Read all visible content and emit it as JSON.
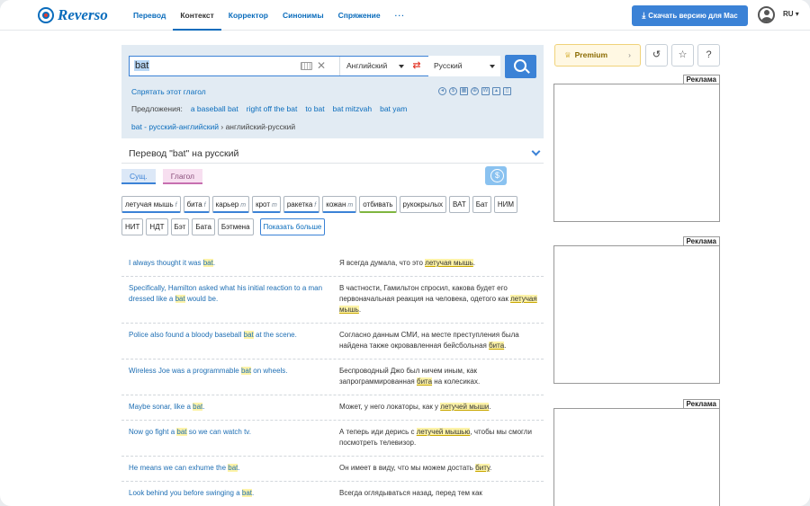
{
  "brand": {
    "name": "Reverso"
  },
  "nav": {
    "items": [
      {
        "label": "Перевод",
        "active": false
      },
      {
        "label": "Контекст",
        "active": true
      },
      {
        "label": "Корректор",
        "active": false
      },
      {
        "label": "Синонимы",
        "active": false
      },
      {
        "label": "Спряжение",
        "active": false
      }
    ],
    "more": "···"
  },
  "header": {
    "mac_button": "Скачать версию для Mac",
    "language": "RU ▾"
  },
  "search": {
    "query": "bat",
    "source_lang": "Английский",
    "target_lang": "Русский",
    "hide_verb": "Спрятать этот глагол",
    "suggestions_label": "Предложения:",
    "suggestions": [
      "a baseball bat",
      "right off the bat",
      "to bat",
      "bat mitzvah",
      "bat yam"
    ],
    "crumb_link": "bat - русский-английский",
    "crumb_sep": "›",
    "crumb_current": "английский-русский"
  },
  "translation": {
    "title": "Перевод \"bat\" на русский",
    "pos_tabs": [
      "Сущ.",
      "Глагол"
    ],
    "chips_row1": [
      {
        "text": "летучая мышь",
        "g": "f",
        "type": "noun"
      },
      {
        "text": "бита",
        "g": "f",
        "type": "noun"
      },
      {
        "text": "карьер",
        "g": "m",
        "type": "noun"
      },
      {
        "text": "крот",
        "g": "m",
        "type": "noun"
      },
      {
        "text": "ракетка",
        "g": "f",
        "type": "noun"
      },
      {
        "text": "кожан",
        "g": "m",
        "type": "noun"
      },
      {
        "text": "отбивать",
        "g": "",
        "type": "verb"
      },
      {
        "text": "рукокрылых",
        "g": "",
        "type": "plain"
      },
      {
        "text": "ВАТ",
        "g": "",
        "type": "plain"
      },
      {
        "text": "Бат",
        "g": "",
        "type": "plain"
      },
      {
        "text": "НИМ",
        "g": "",
        "type": "plain"
      }
    ],
    "chips_row2": [
      {
        "text": "НИТ",
        "g": "",
        "type": "plain"
      },
      {
        "text": "НДТ",
        "g": "",
        "type": "plain"
      },
      {
        "text": "Бэт",
        "g": "",
        "type": "plain"
      },
      {
        "text": "Бата",
        "g": "",
        "type": "plain"
      },
      {
        "text": "Бэтмена",
        "g": "",
        "type": "plain"
      }
    ],
    "show_more": "Показать больше"
  },
  "examples": [
    {
      "src": [
        "I always thought it was ",
        "bat",
        "."
      ],
      "tgt": [
        "Я всегда думала, что это ",
        "летучая мышь",
        "."
      ]
    },
    {
      "src": [
        "Specifically, Hamilton asked what his initial reaction to a man dressed like a ",
        "bat",
        " would be."
      ],
      "tgt": [
        "В частности, Гамильтон спросил, какова будет его первоначальная реакция на человека, одетого как ",
        "летучая мышь",
        "."
      ]
    },
    {
      "src": [
        "Police also found a bloody baseball ",
        "bat",
        " at the scene."
      ],
      "tgt": [
        "Согласно данным СМИ, на месте преступления была найдена также окровавленная бейсбольная ",
        "бита",
        "."
      ]
    },
    {
      "src": [
        "Wireless Joe was a programmable ",
        "bat",
        " on wheels."
      ],
      "tgt": [
        "Беспроводный Джо был ничем иным, как запрограммированная ",
        "бита",
        " на колесиках."
      ]
    },
    {
      "src": [
        "Maybe sonar, like a ",
        "bat",
        "."
      ],
      "tgt": [
        "Может, у него локаторы, как у ",
        "летучей мыши",
        "."
      ]
    },
    {
      "src": [
        "Now go fight a ",
        "bat",
        " so we can watch tv."
      ],
      "tgt": [
        "А теперь иди дерись с ",
        "летучей мышью",
        ", чтобы мы смогли посмотреть телевизор."
      ]
    },
    {
      "src": [
        "He means we can exhume the ",
        "bat",
        "."
      ],
      "tgt": [
        "Он имеет в виду, что мы можем достать ",
        "биту",
        "."
      ]
    },
    {
      "src": [
        "Look behind you before swinging a ",
        "bat",
        "."
      ],
      "tgt": [
        "Всегда оглядываться назад, перед тем как",
        "",
        ""
      ]
    }
  ],
  "sidebar": {
    "premium": "Premium",
    "ad_label": "Реклама"
  }
}
